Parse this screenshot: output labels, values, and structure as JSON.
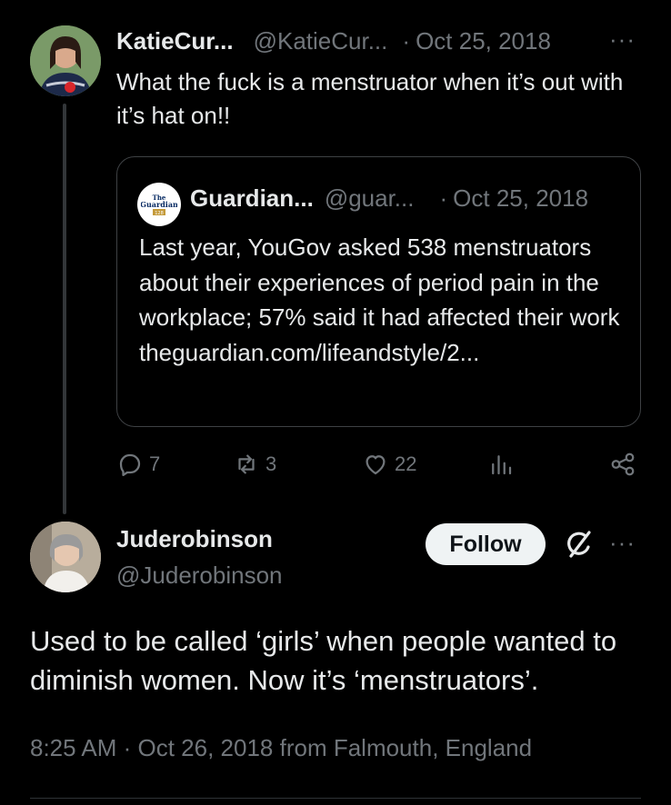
{
  "tweet1": {
    "display_name": "KatieCur...",
    "handle": "@KatieCur...",
    "separator": "·",
    "date": "Oct 25, 2018",
    "text": "What the fuck is a menstruator when it’s out with it’s hat on!!",
    "more": "···"
  },
  "quote": {
    "display_name": "Guardian...",
    "handle": "@guar...",
    "separator": "·",
    "date": "Oct 25, 2018",
    "avatar_text": "The Guardian 128",
    "text": "Last year, YouGov asked 538 menstruators about their experiences of period pain in the workplace; 57% said it had affected their work theguardian.com/lifeandstyle/2..."
  },
  "actions": {
    "replies": "7",
    "reposts": "3",
    "likes": "22",
    "reply_icon": "reply-icon",
    "repost_icon": "repost-icon",
    "like_icon": "heart-icon",
    "views_icon": "views-icon",
    "share_icon": "share-icon"
  },
  "tweet2": {
    "display_name": "Juderobinson",
    "handle": "@Juderobinson",
    "follow_label": "Follow",
    "more": "···",
    "text": "Used to be called ‘girls’ when people wanted to diminish women. Now it’s ‘menstruators’.",
    "meta": "8:25 AM · Oct 26, 2018 from Falmouth, England"
  },
  "colors": {
    "background": "#000000",
    "text": "#e7e9ea",
    "muted": "#71767b",
    "border": "#2f3336"
  }
}
